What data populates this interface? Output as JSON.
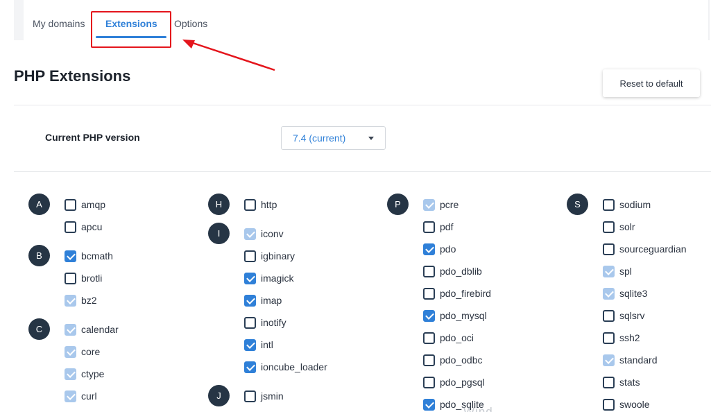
{
  "tabs": [
    {
      "label": "My domains",
      "active": false
    },
    {
      "label": "Extensions",
      "active": true
    },
    {
      "label": "Options",
      "active": false
    }
  ],
  "page": {
    "title": "PHP Extensions",
    "reset_label": "Reset to default"
  },
  "php_version": {
    "label": "Current PHP version",
    "selected": "7.4 (current)"
  },
  "colors": {
    "accent": "#2f80d8",
    "annotation": "#e4151c",
    "letter_badge": "#263545",
    "checkbox_disabled": "#a9c8ec"
  },
  "letters": [
    "A",
    "B",
    "C",
    "H",
    "I",
    "J",
    "P",
    "S"
  ],
  "extensions": [
    {
      "name": "amqp",
      "state": "off"
    },
    {
      "name": "apcu",
      "state": "off"
    },
    {
      "name": "bcmath",
      "state": "on"
    },
    {
      "name": "brotli",
      "state": "off"
    },
    {
      "name": "bz2",
      "state": "disabled"
    },
    {
      "name": "calendar",
      "state": "disabled"
    },
    {
      "name": "core",
      "state": "disabled"
    },
    {
      "name": "ctype",
      "state": "disabled"
    },
    {
      "name": "curl",
      "state": "disabled"
    },
    {
      "name": "http",
      "state": "off"
    },
    {
      "name": "iconv",
      "state": "disabled"
    },
    {
      "name": "igbinary",
      "state": "off"
    },
    {
      "name": "imagick",
      "state": "on"
    },
    {
      "name": "imap",
      "state": "on"
    },
    {
      "name": "inotify",
      "state": "off"
    },
    {
      "name": "intl",
      "state": "on"
    },
    {
      "name": "ioncube_loader",
      "state": "on"
    },
    {
      "name": "jsmin",
      "state": "off"
    },
    {
      "name": "pcre",
      "state": "disabled"
    },
    {
      "name": "pdf",
      "state": "off"
    },
    {
      "name": "pdo",
      "state": "on"
    },
    {
      "name": "pdo_dblib",
      "state": "off"
    },
    {
      "name": "pdo_firebird",
      "state": "off"
    },
    {
      "name": "pdo_mysql",
      "state": "on"
    },
    {
      "name": "pdo_oci",
      "state": "off"
    },
    {
      "name": "pdo_odbc",
      "state": "off"
    },
    {
      "name": "pdo_pgsql",
      "state": "off"
    },
    {
      "name": "pdo_sqlite",
      "state": "on"
    },
    {
      "name": "sodium",
      "state": "off"
    },
    {
      "name": "solr",
      "state": "off"
    },
    {
      "name": "sourceguardian",
      "state": "off"
    },
    {
      "name": "spl",
      "state": "disabled"
    },
    {
      "name": "sqlite3",
      "state": "disabled"
    },
    {
      "name": "sqlsrv",
      "state": "off"
    },
    {
      "name": "ssh2",
      "state": "off"
    },
    {
      "name": "standard",
      "state": "disabled"
    },
    {
      "name": "stats",
      "state": "off"
    },
    {
      "name": "swoole",
      "state": "off"
    }
  ],
  "watermark": "Wind"
}
